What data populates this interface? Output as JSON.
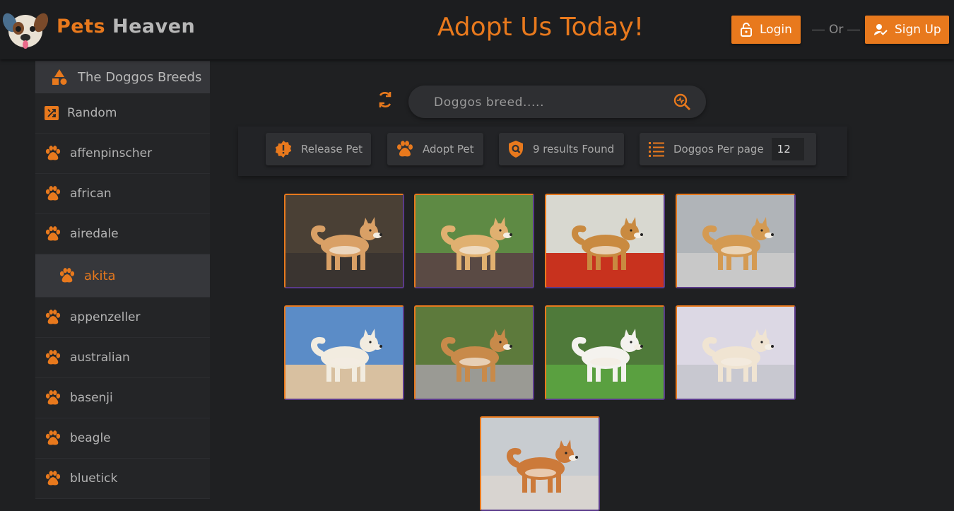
{
  "header": {
    "brand_part1": "Pets",
    "brand_part2": "Heaven",
    "headline": "Adopt Us Today!",
    "login_label": "Login",
    "or_label": "Or",
    "signup_label": "Sign Up"
  },
  "colors": {
    "accent": "#e8791d",
    "background": "#1f2022",
    "card_border_alt": "#5a3a8a"
  },
  "sidebar": {
    "heading": "The Doggos Breeds",
    "random_label": "Random",
    "items": [
      {
        "label": "affenpinscher",
        "active": false
      },
      {
        "label": "african",
        "active": false
      },
      {
        "label": "airedale",
        "active": false
      },
      {
        "label": "akita",
        "active": true
      },
      {
        "label": "appenzeller",
        "active": false
      },
      {
        "label": "australian",
        "active": false
      },
      {
        "label": "basenji",
        "active": false
      },
      {
        "label": "beagle",
        "active": false
      },
      {
        "label": "bluetick",
        "active": false
      }
    ]
  },
  "search": {
    "placeholder": "Doggos breed.....",
    "value": ""
  },
  "toolbar": {
    "release_label": "Release Pet",
    "adopt_label": "Adopt Pet",
    "results_label": "9 results Found",
    "per_page_label": "Doggos Per page",
    "per_page_value": "12"
  },
  "icons": {
    "logo": "dog-face-icon",
    "login": "lock-icon",
    "signup": "user-check-icon",
    "sidebar_heading": "shapes-icon",
    "random": "shuffle-icon",
    "breed": "paw-icon",
    "refresh": "refresh-icon",
    "search": "search-zoom-icon",
    "release": "alert-badge-icon",
    "adopt": "paw-icon",
    "results": "shield-search-icon",
    "per_page": "list-icon"
  },
  "gallery": {
    "count": 9,
    "images": [
      {
        "subject": "akita-dog-photo-1"
      },
      {
        "subject": "akita-dog-photo-2"
      },
      {
        "subject": "akita-dog-photo-3"
      },
      {
        "subject": "akita-dog-photo-4"
      },
      {
        "subject": "akita-dog-photo-5"
      },
      {
        "subject": "akita-dog-photo-6"
      },
      {
        "subject": "akita-dog-photo-7"
      },
      {
        "subject": "akita-dog-photo-8"
      },
      {
        "subject": "akita-dog-photo-9"
      }
    ]
  }
}
